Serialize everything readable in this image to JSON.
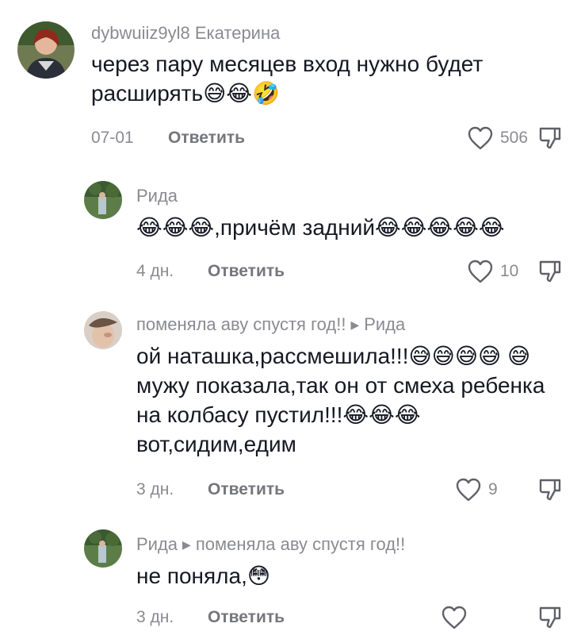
{
  "comments": [
    {
      "author": "dybwuiiz9yl8 Екатерина",
      "text": "через пару месяцев вход нужно будет расширять😅😂🤣",
      "date": "07-01",
      "reply_label": "Ответить",
      "likes": "506"
    },
    {
      "author": "Рида",
      "text": "😂😂😂,причём задний😂😂😂😂😂",
      "date": "4 дн.",
      "reply_label": "Ответить",
      "likes": "10"
    },
    {
      "author": "поменяла аву спустя год!!",
      "reply_to": "Рида",
      "text": "ой наташка,рассмешила!!!😅😅😅😅 😅 мужу показала,так он от смеха ребенка на колбасу пустил!!!😂😂😂 вот,сидим,едим",
      "date": "3 дн.",
      "reply_label": "Ответить",
      "likes": "9"
    },
    {
      "author": "Рида",
      "reply_to": "поменяла аву спустя год!!",
      "text": "не поняла,😳",
      "date": "3 дн.",
      "reply_label": "Ответить",
      "likes": ""
    }
  ],
  "icons": {
    "like": "heart-outline-icon",
    "dislike": "thumbs-down-outline-icon",
    "reply_arrow": "triangle-right-icon"
  },
  "colors": {
    "text": "#161823",
    "muted": "#8a8b91",
    "reply": "#75767c"
  }
}
